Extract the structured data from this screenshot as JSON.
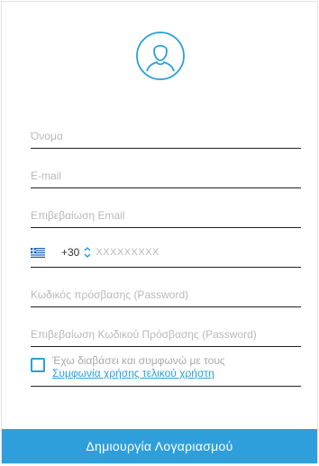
{
  "form": {
    "name_placeholder": "Όνομα",
    "email_placeholder": "E-mail",
    "email_confirm_placeholder": "Επιβεβαίωση Email",
    "phone": {
      "country_code": "+30",
      "placeholder": "XXXXXXXXX",
      "flag": "greece-flag"
    },
    "password_placeholder": "Κωδικός πρόσβασης (Password)",
    "password_confirm_placeholder": "Επιβεβαίωση Κωδικού Πρόσβασης (Password)",
    "agreement": {
      "checked": false,
      "text": "Έχω διαβάσει και συμφωνώ με τους",
      "link": "Συμφωνία χρήσης τελικού χρήστη"
    },
    "submit_label": "Δημιουργία Λογαριασμού"
  },
  "icons": {
    "avatar": "user-avatar-icon",
    "stepper": "chevron-up-down-icon"
  },
  "colors": {
    "accent": "#2f9fdc",
    "placeholder": "#b9b9b9",
    "underline": "#222222"
  }
}
